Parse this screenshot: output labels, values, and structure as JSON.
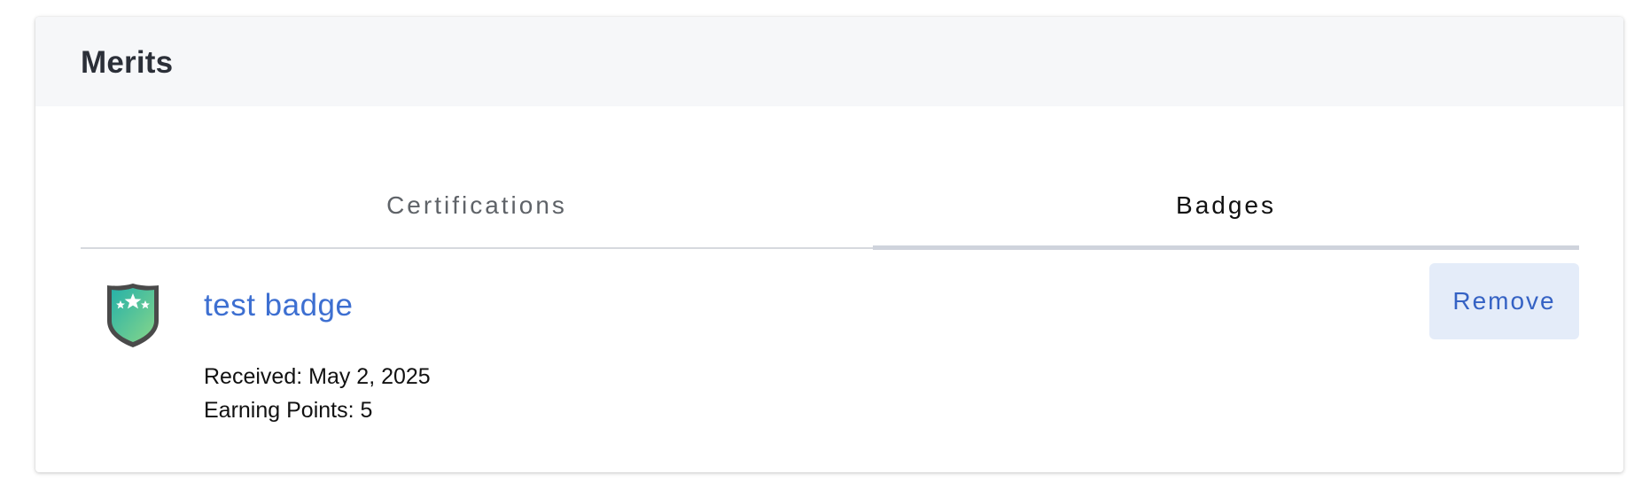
{
  "header": {
    "title": "Merits"
  },
  "tabs": [
    {
      "label": "Certifications",
      "active": false
    },
    {
      "label": "Badges",
      "active": true
    }
  ],
  "badges": [
    {
      "name": "test badge",
      "received": "Received: May 2, 2025",
      "earning_points": "Earning Points: 5",
      "icon": "shield-star-icon",
      "remove_label": "Remove"
    }
  ],
  "colors": {
    "link": "#3d6fd1",
    "button_bg": "#e4ecf9",
    "button_text": "#3562c4",
    "header_bg": "#f6f7f9",
    "badge_gradient_start": "#2fb8a6",
    "badge_gradient_end": "#7fd28e"
  }
}
